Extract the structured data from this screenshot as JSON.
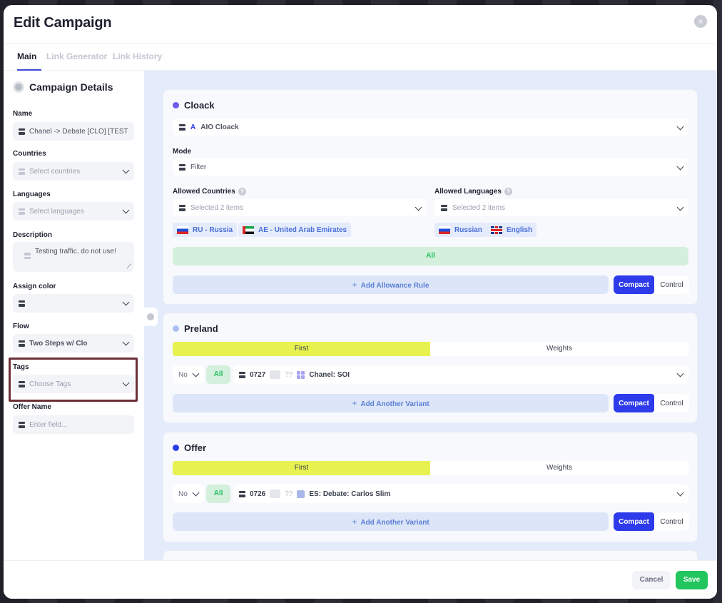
{
  "modal": {
    "title": "Edit Campaign",
    "close_icon": "×"
  },
  "tabs": [
    {
      "label": "Main"
    },
    {
      "label": "Link Generator"
    },
    {
      "label": "Link History"
    }
  ],
  "sidebar": {
    "section_title": "Campaign Details",
    "name": {
      "label": "Name",
      "value": "Chanel -> Debate [CLO] [TEST"
    },
    "countries": {
      "label": "Countries",
      "placeholder": "Select countries"
    },
    "languages": {
      "label": "Languages",
      "placeholder": "Select languages"
    },
    "description": {
      "label": "Description",
      "value": "Testing traffic, do not use!"
    },
    "assign_color": {
      "label": "Assign color"
    },
    "flow": {
      "label": "Flow",
      "value": "Two Steps w/ Clo"
    },
    "tags": {
      "label": "Tags",
      "placeholder": "Choose Tags"
    },
    "offer_name": {
      "label": "Offer Name",
      "placeholder": "Enter field..."
    }
  },
  "cloack": {
    "title": "Cloack",
    "dot_color": "#6d5ce8",
    "service": {
      "icon": "A",
      "value": "AIO Cloack"
    },
    "mode": {
      "label": "Mode",
      "value": "Filter"
    },
    "allowed_countries": {
      "label": "Allowed Countries",
      "placeholder": "Selected 2 items",
      "chips": [
        "RU - Russia",
        "AE - United Arab Emirates"
      ]
    },
    "allowed_languages": {
      "label": "Allowed Languages",
      "placeholder": "Selected 2 items",
      "chips": [
        "Russian",
        "English"
      ]
    },
    "all_label": "All",
    "add_rule": "Add Allowance Rule",
    "compact": "Compact",
    "control": "Control"
  },
  "preland": {
    "title": "Preland",
    "dot_color": "#a9c0f0",
    "split_first": "First",
    "split_weights": "Weights",
    "no_value": "No",
    "all_label": "All",
    "variant": {
      "id": "0727",
      "qq": "??",
      "name": "Chanel: SOI"
    },
    "add_variant": "Add Another Variant",
    "compact": "Compact",
    "control": "Control"
  },
  "offer": {
    "title": "Offer",
    "dot_color": "#2d3bea",
    "split_first": "First",
    "split_weights": "Weights",
    "no_value": "No",
    "all_label": "All",
    "variant": {
      "id": "0726",
      "qq": "??",
      "name": "ES: Debate: Carlos Slim"
    },
    "add_variant": "Add Another Variant",
    "compact": "Compact",
    "control": "Control"
  },
  "footer": {
    "cancel": "Cancel",
    "save": "Save"
  },
  "colors": {
    "accent": "#2d3bea",
    "save": "#22c55e",
    "highlight": "#e7f250"
  }
}
